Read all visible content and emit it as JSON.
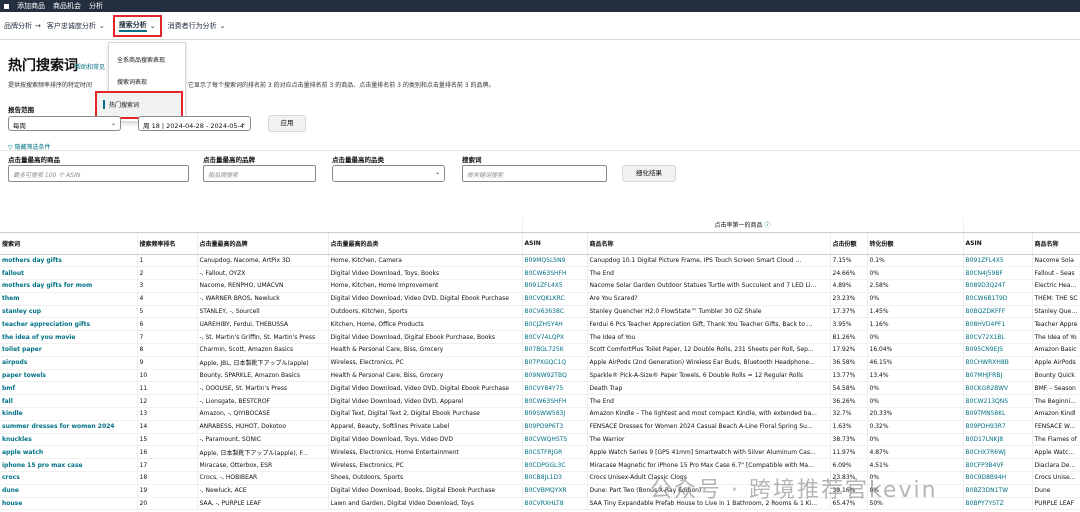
{
  "topbar": {
    "items": [
      "添加商品",
      "商品机会",
      "分析"
    ]
  },
  "subnav": {
    "brand": "品牌分析",
    "arrow": "→",
    "customer": "客户忠诚度分析",
    "search": "搜索分析",
    "consumer": "消费者行为分析"
  },
  "dropdown": {
    "options": [
      "全系商品搜索表现",
      "搜索词表现",
      "热门搜索词"
    ]
  },
  "page": {
    "title": "热门搜索词",
    "help": "帮助和常见",
    "desc1": "提供按搜索频率排序的特定时间",
    "desc2": "它显示了每个搜索词的排名前 3 的对应点击量排名前 3 的商品、点击量排名前 3 的类别和点击量排名前 3 的品牌。"
  },
  "filters": {
    "report_range": "报告范围",
    "range_value": "每周",
    "week_value": "周 18 | 2024-04-28 - 2024-05-4",
    "apply": "应用",
    "hide": "隐藏筛选条件",
    "top_product": "点击量最高的商品",
    "top_brand": "点击量最高的品牌",
    "top_category": "点击量最高的品类",
    "keyword": "搜索词",
    "asin_ph": "最多可搜索 100 个 ASIN",
    "brand_ph": "按品牌搜索",
    "kw_ph": "按关键词搜索",
    "refine": "细化结果"
  },
  "table": {
    "group_header": "点击率第一的商品",
    "headers": [
      "搜索词",
      "搜索频率排名",
      "点击量最高的品牌",
      "点击量最高的品类",
      "ASIN",
      "商品名称",
      "点击份额",
      "转化份额",
      "ASIN",
      "商品名称"
    ],
    "rows": [
      [
        "mothers day gifts",
        "1",
        "Canupdog, Nacome, ArtPix 3D",
        "Home, Kitchen, Camera",
        "B09MQ5LSN9",
        "Canupdog 10.1 Digital Picture Frame, IPS Touch Screen Smart Cloud ...",
        "7.15%",
        "0.1%",
        "B091ZFL4X5",
        "Nacome Sola"
      ],
      [
        "fallout",
        "2",
        "-, Fallout, OYZX",
        "Digital Video Download, Toys, Books",
        "B0CW63SHFH",
        "The End",
        "24.66%",
        "0%",
        "B0CN4J59BF",
        "Fallout - Seas"
      ],
      [
        "mothers day gifts for mom",
        "3",
        "Nacome, RENPHO, UMACVN",
        "Home, Kitchen, Home Improvement",
        "B091ZFL4X5",
        "Nacome Solar Garden Outdoor Statues Turtle with Succulent and 7 LED Li...",
        "4.89%",
        "2.58%",
        "B089D3Q24T",
        "Electric Heatin"
      ],
      [
        "them",
        "4",
        "-, WARNER BROS, Newluck",
        "Digital Video Download, Video DVD, Digital Ebook Purchase",
        "B0CVQKLKRC",
        "Are You Scared?",
        "23.23%",
        "0%",
        "B0CW6B1T9D",
        "THEM: THE SC"
      ],
      [
        "stanley cup",
        "5",
        "STANLEY, -, Sourcell",
        "Outdoors, Kitchen, Sports",
        "B0CV63638C",
        "Stanley Quencher H2.0 FlowState™ Tumbler 30 OZ Shale",
        "17.37%",
        "1.45%",
        "B0BQZDKFFF",
        "Stanley Quenc"
      ],
      [
        "teacher appreciation gifts",
        "6",
        "UAREHIBY, Ferdui, THEBUSSA",
        "Kitchen, Home, Office Products",
        "B0CJZHSY4H",
        "Ferdui 6 Pcs Teacher Appreciation Gift, Thank You Teacher Gifts, Back to ...",
        "3.95%",
        "1.16%",
        "B08HVD4PF1",
        "Teacher Appre"
      ],
      [
        "the idea of you movie",
        "7",
        "-, St. Martin's Griffin, St. Martin's Press",
        "Digital Video Download, Digital Ebook Purchase, Books",
        "B0CV74LQPX",
        "The Idea of You",
        "81.26%",
        "0%",
        "B0CV72X1BL",
        "The Idea of Yo"
      ],
      [
        "toilet paper",
        "8",
        "Charmin, Scott, Amazon Basics",
        "Health & Personal Care, Biss, Grocery",
        "B07BGL725K",
        "Scott ComfortPlus Toilet Paper, 12 Double Rolls, 231 Sheets per Roll, Sep...",
        "17.92%",
        "16.04%",
        "B095CN9EJS",
        "Amazon Basic"
      ],
      [
        "airpods",
        "9",
        "Apple, JBL, 日本製靴下アップル(apple)",
        "Wireless, Electronics, PC",
        "B07PXGQC1Q",
        "Apple AirPods (2nd Generation) Wireless Ear Buds, Bluetooth Headphone...",
        "36.58%",
        "46.15%",
        "B0CHWRXH8B",
        "Apple AirPods"
      ],
      [
        "paper towels",
        "10",
        "Bounty, SPARKLE, Amazon Basics",
        "Health & Personal Care, Biss, Grocery",
        "B09NW92TBQ",
        "Sparkle® Pick-A-Size® Paper Towels, 6 Double Rolls = 12 Regular Rolls",
        "13.77%",
        "13.4%",
        "B07MHJFRBJ",
        "Bounty Quick"
      ],
      [
        "bmf",
        "11",
        "-, OOOUSE, St. Martin's Press",
        "Digital Video Download, Video DVD, Digital Ebook Purchase",
        "B0CVY84Y75",
        "Death Trap",
        "54.58%",
        "0%",
        "B0CKGR2BWV",
        "BMF – Season"
      ],
      [
        "fall",
        "12",
        "-, Lionsgate, BESTCROF",
        "Digital Video Download, Video DVD, Apparel",
        "B0CW63SHFH",
        "The End",
        "36.26%",
        "0%",
        "B0CW213QNS",
        "The Beginning"
      ],
      [
        "kindle",
        "13",
        "Amazon, -, QIYIBOCASE",
        "Digital Text, Digital Text 2, Digital Ebook Purchase",
        "B09SWW583J",
        "Amazon Kindle – The lightest and most compact Kindle, with extended ba...",
        "32.7%",
        "20.33%",
        "B09TMN58KL",
        "Amazon Kindl"
      ],
      [
        "summer dresses for women 2024",
        "14",
        "ANRABESS, HUHOT, Dokotoo",
        "Apparel, Beauty, Softlines Private Label",
        "B09PD9P6T3",
        "FENSACE Dresses for Women 2024 Casual Beach A-Line Floral Spring Su...",
        "1.63%",
        "0.32%",
        "B09PDH93R7",
        "FENSACE Wom"
      ],
      [
        "knuckles",
        "15",
        "-, Paramount, SONIC",
        "Digital Video Download, Toys, Video DVD",
        "B0CVWQHSTS",
        "The Warrior",
        "38.73%",
        "0%",
        "B0D17LNKJ8",
        "The Flames of"
      ],
      [
        "apple watch",
        "16",
        "Apple, 日本製靴下アップル(apple), F...",
        "Wireless, Electronics, Home Entertainment",
        "B0CSTFRJGR",
        "Apple Watch Series 9 [GPS 41mm] Smartwatch with Silver Aluminum Cas...",
        "11.97%",
        "4.87%",
        "B0CHX7R6WJ",
        "Apple Watch S"
      ],
      [
        "iphone 15 pro max case",
        "17",
        "Miracase, Otterbox, ESR",
        "Wireless, Electronics, PC",
        "B0CDPGGL3C",
        "Miracase Magnetic for iPhone 15 Pro Max Case 6.7\" [Compatible with Ma...",
        "6.09%",
        "4.51%",
        "B0CFP3B4VF",
        "Diaclara Desig"
      ],
      [
        "crocs",
        "18",
        "Crocs, -, HOBIBEAR",
        "Shoes, Outdoors, Sports",
        "B0CB8JL1D3",
        "Crocs Unisex-Adult Classic Clogs",
        "23.83%",
        "0%",
        "B0C9D8B94H",
        "Crocs Unisex-A"
      ],
      [
        "dune",
        "19",
        "-, Newluck, ACE",
        "Digital Video Download, Books, Digital Ebook Purchase",
        "B0CVBMQYXR",
        "Dune: Part Two (Bonus X-Ray Edition)",
        "39.16%",
        "0%",
        "B0BZ3DN1TW",
        "Dune"
      ],
      [
        "house",
        "20",
        "SAA, -, PURPLE LEAF",
        "Lawn and Garden, Digital Video Download, Toys",
        "B0CVRXHLT8",
        "SAA Tiny Expandable Prefab House to Live in 1 Bathroom, 2 Rooms & 1 Ki...",
        "65.47%",
        "50%",
        "B0BPY7YSTZ",
        "PURPLE LEAF"
      ]
    ]
  },
  "watermark": "公众号 · 跨境推荐官kevin"
}
